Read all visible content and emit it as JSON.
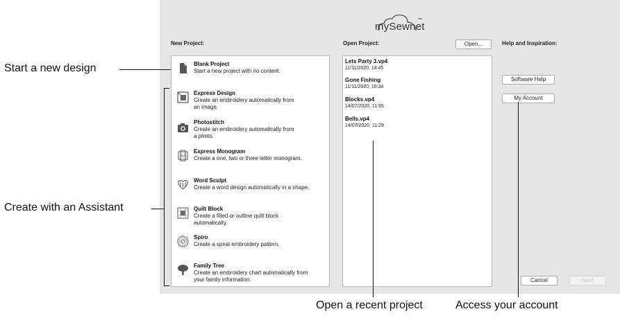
{
  "brand": {
    "logo_text": "mySewnet"
  },
  "new_project": {
    "heading": "New Project:",
    "items": [
      {
        "icon": "blank-page-icon",
        "title": "Blank Project",
        "desc1": "Start a new project with no content.",
        "desc2": ""
      },
      {
        "icon": "express-design-icon",
        "title": "Express Design",
        "desc1": "Create an embroidery automatically from",
        "desc2": "an image."
      },
      {
        "icon": "camera-icon",
        "title": "Photostitch",
        "desc1": "Create an embroidery automatically from",
        "desc2": "a photo."
      },
      {
        "icon": "monogram-icon",
        "title": "Express Monogram",
        "desc1": "Create a one, two or three letter monogram.",
        "desc2": ""
      },
      {
        "icon": "word-sculpt-icon",
        "title": "Word Sculpt",
        "desc1": "Create a word design automatically in a shape.",
        "desc2": ""
      },
      {
        "icon": "quilt-block-icon",
        "title": "Quilt Block",
        "desc1": "Create a filled or outline quilt block",
        "desc2": "automatically."
      },
      {
        "icon": "spiro-icon",
        "title": "Spiro",
        "desc1": "Create a spiral embroidery pattern.",
        "desc2": ""
      },
      {
        "icon": "tree-icon",
        "title": "Family Tree",
        "desc1": "Create an embroidery chart automatically from",
        "desc2": "your family information."
      }
    ]
  },
  "open_project": {
    "heading": "Open Project:",
    "open_button": "Open...",
    "recent": [
      {
        "name": "Lets Party 3.vp4",
        "date": "11/11/2020, 14:45"
      },
      {
        "name": "Gone Fishing",
        "date": "11/11/2020, 10:34"
      },
      {
        "name": "Blocks.vp4",
        "date": "14/07/2020, 11:55"
      },
      {
        "name": "Bells.vp4",
        "date": "14/07/2020, 11:29"
      }
    ]
  },
  "help": {
    "heading": "Help and Inspiration:",
    "software_help": "Software Help",
    "my_account": "My Account"
  },
  "footer": {
    "cancel": "Cancel",
    "next": "Next"
  },
  "callouts": {
    "start_new": "Start a new design",
    "assistant": "Create with an Assistant",
    "recent": "Open a recent project",
    "account": "Access your account"
  }
}
